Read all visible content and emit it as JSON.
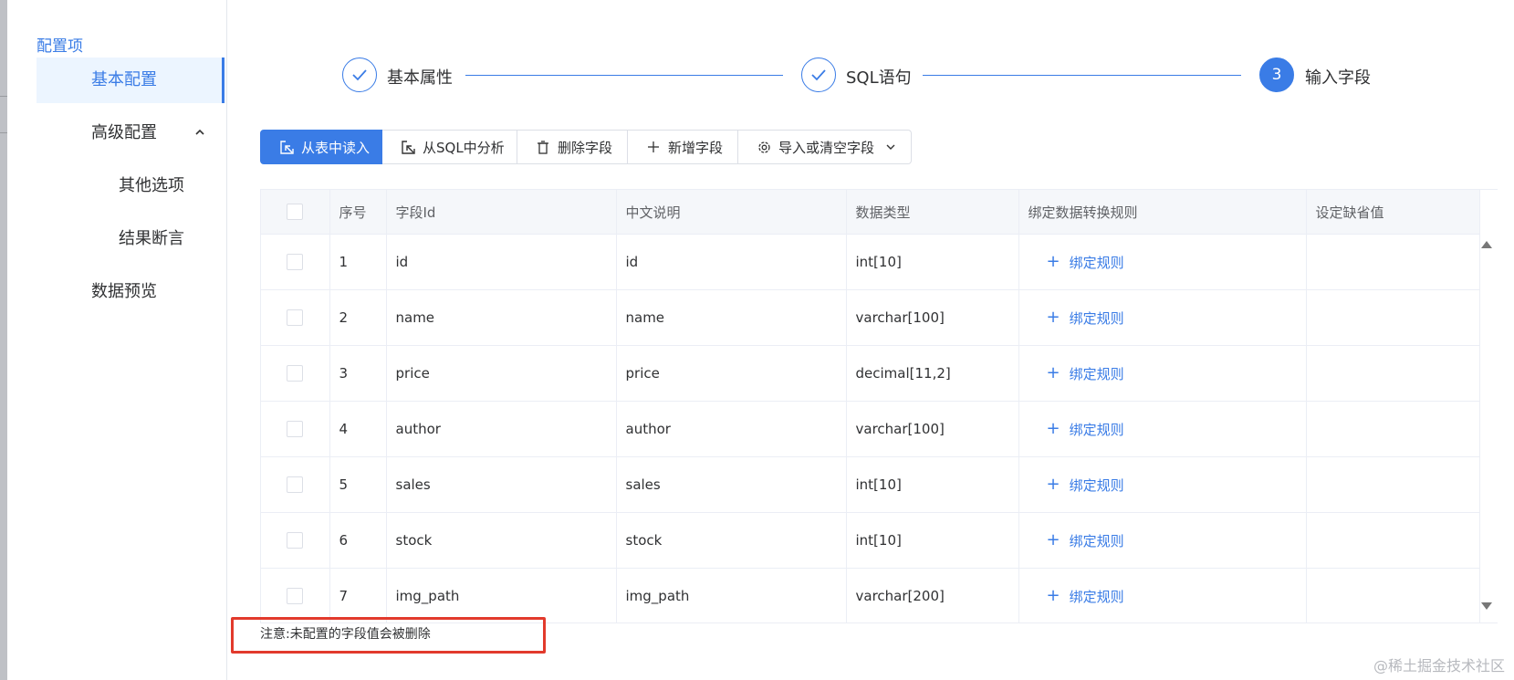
{
  "sidebar": {
    "header": "配置项",
    "items": [
      {
        "label": "基本配置",
        "active": true
      },
      {
        "label": "高级配置",
        "expanded": true
      },
      {
        "label": "其他选项",
        "sub": true
      },
      {
        "label": "结果断言",
        "sub": true
      },
      {
        "label": "数据预览"
      }
    ]
  },
  "steps": [
    {
      "title": "基本属性",
      "status": "done",
      "icon": "check-icon"
    },
    {
      "title": "SQL语句",
      "status": "done",
      "icon": "check-icon"
    },
    {
      "title": "输入字段",
      "status": "current",
      "number": "3"
    }
  ],
  "toolbar": {
    "buttons": [
      {
        "label": "从表中读入",
        "icon": "select-icon",
        "primary": true
      },
      {
        "label": "从SQL中分析",
        "icon": "select-icon"
      },
      {
        "label": "删除字段",
        "icon": "trash-icon"
      },
      {
        "label": "新增字段",
        "icon": "plus-icon"
      },
      {
        "label": "导入或清空字段",
        "icon": "gear-icon",
        "dropdown": true
      }
    ]
  },
  "table": {
    "columns": [
      "序号",
      "字段Id",
      "中文说明",
      "数据类型",
      "绑定数据转换规则",
      "设定缺省值"
    ],
    "bind_label": "绑定规则",
    "rows": [
      {
        "index": "1",
        "field_id": "id",
        "desc": "id",
        "type": "int[10]",
        "default": ""
      },
      {
        "index": "2",
        "field_id": "name",
        "desc": "name",
        "type": "varchar[100]",
        "default": ""
      },
      {
        "index": "3",
        "field_id": "price",
        "desc": "price",
        "type": "decimal[11,2]",
        "default": ""
      },
      {
        "index": "4",
        "field_id": "author",
        "desc": "author",
        "type": "varchar[100]",
        "default": ""
      },
      {
        "index": "5",
        "field_id": "sales",
        "desc": "sales",
        "type": "int[10]",
        "default": ""
      },
      {
        "index": "6",
        "field_id": "stock",
        "desc": "stock",
        "type": "int[10]",
        "default": ""
      },
      {
        "index": "7",
        "field_id": "img_path",
        "desc": "img_path",
        "type": "varchar[200]",
        "default": ""
      }
    ]
  },
  "notice": "注意:未配置的字段值会被删除",
  "watermark": "@稀土掘金技术社区",
  "colors": {
    "primary": "#3a7ce6",
    "highlight": "#e23a2c",
    "border": "#ebeef5"
  }
}
